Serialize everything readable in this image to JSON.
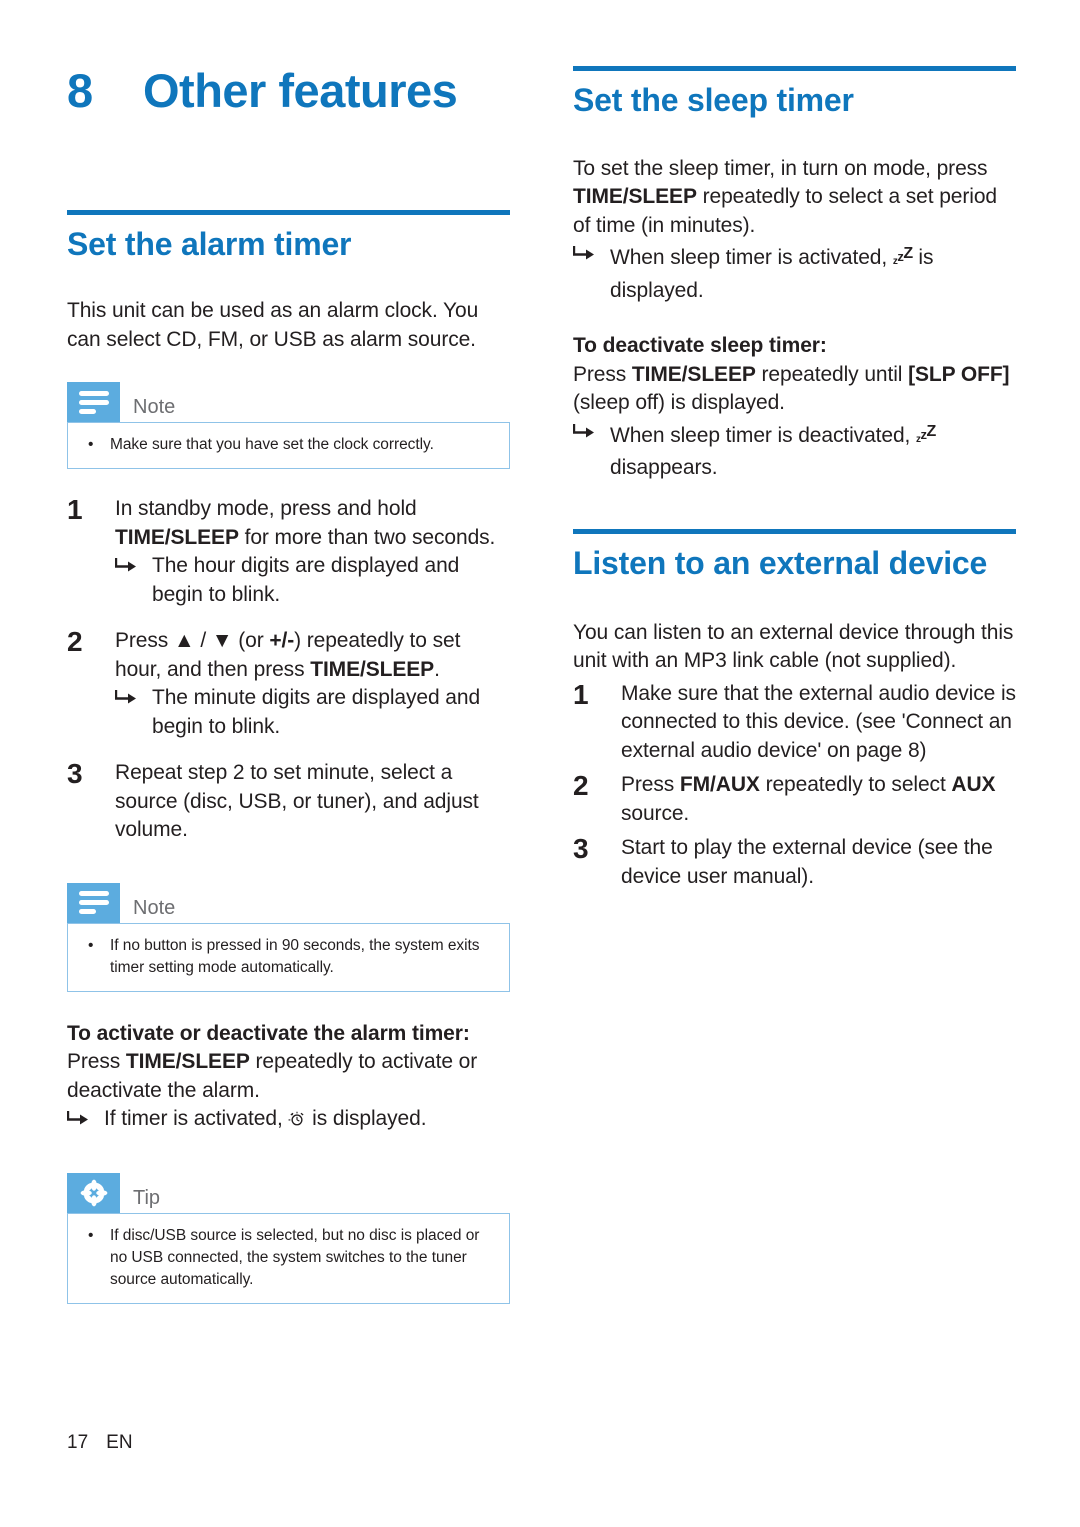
{
  "chapter": {
    "number": "8",
    "title": "Other features"
  },
  "footer": {
    "page": "17",
    "lang": "EN"
  },
  "colors": {
    "heading_blue": "#0f76bc",
    "callout_icon_blue": "#5cacdf",
    "callout_border_blue": "#8fc3e8",
    "body_text": "#231f20",
    "callout_label_gray": "#6d6e71"
  },
  "left_column": {
    "alarm_section": {
      "title": "Set the alarm timer",
      "intro": "This unit can be used as an alarm clock. You can select CD, FM, or USB as alarm source.",
      "note1": {
        "label": "Note",
        "icon": "note-lines-icon",
        "items": [
          "Make sure that you have set the clock correctly."
        ]
      },
      "steps": [
        {
          "num": "1",
          "text_parts": [
            {
              "t": "In standby mode, press and hold ",
              "b": false
            },
            {
              "t": "TIME/SLEEP",
              "b": true
            },
            {
              "t": " for more than two seconds.",
              "b": false
            }
          ],
          "results": [
            "The hour digits are displayed and begin to blink."
          ]
        },
        {
          "num": "2",
          "text_parts": [
            {
              "t": "Press ▲ / ▼ (or ",
              "b": false
            },
            {
              "t": "+/-",
              "b": true
            },
            {
              "t": ") repeatedly to set hour, and then press ",
              "b": false
            },
            {
              "t": "TIME/SLEEP",
              "b": true
            },
            {
              "t": ".",
              "b": false
            }
          ],
          "results": [
            "The minute digits are displayed and begin to blink."
          ]
        },
        {
          "num": "3",
          "text_parts": [
            {
              "t": "Repeat step 2 to set minute, select a source (disc, USB, or tuner), and adjust volume.",
              "b": false
            }
          ],
          "results": []
        }
      ],
      "note2": {
        "label": "Note",
        "icon": "note-lines-icon",
        "items": [
          "If no button is pressed in 90 seconds, the system exits timer setting mode automatically."
        ]
      },
      "activate_heading": "To activate or deactivate the alarm timer:",
      "activate_parts": [
        {
          "t": "Press ",
          "b": false
        },
        {
          "t": "TIME/SLEEP",
          "b": true
        },
        {
          "t": " repeatedly to activate or deactivate the alarm.",
          "b": false
        }
      ],
      "activate_result_before": "If timer is activated, ",
      "activate_result_glyph": "alarm-clock-glyph",
      "activate_result_after": " is displayed.",
      "tip": {
        "label": "Tip",
        "icon": "tip-asterisk-icon",
        "items": [
          "If disc/USB source is selected, but no disc is placed or no USB connected, the system switches to the tuner source automatically."
        ]
      }
    }
  },
  "right_column": {
    "sleep_section": {
      "title": "Set the sleep timer",
      "intro_parts": [
        {
          "t": "To set the sleep timer, in turn on mode, press ",
          "b": false
        },
        {
          "t": "TIME/SLEEP",
          "b": true
        },
        {
          "t": " repeatedly to select a set period of time (in minutes).",
          "b": false
        }
      ],
      "intro_result_before": "When sleep timer is activated, ",
      "intro_result_glyph": "sleep-zzz-glyph",
      "intro_result_after": " is displayed.",
      "deactivate_heading": "To deactivate sleep timer:",
      "deactivate_parts": [
        {
          "t": "Press ",
          "b": false
        },
        {
          "t": "TIME/SLEEP",
          "b": true
        },
        {
          "t": " repeatedly until ",
          "b": false
        },
        {
          "t": "[SLP OFF]",
          "b": true
        },
        {
          "t": " (sleep off) is displayed.",
          "b": false
        }
      ],
      "deactivate_result_before": "When sleep timer is deactivated, ",
      "deactivate_result_glyph": "sleep-zzz-glyph",
      "deactivate_result_after": " disappears."
    },
    "external_section": {
      "title": "Listen to an external device",
      "intro": "You can listen to an external device through this unit with an MP3 link cable (not supplied).",
      "steps": [
        {
          "num": "1",
          "text_parts": [
            {
              "t": "Make sure that the external audio device is connected to this device. (see 'Connect an external audio device' on page 8)",
              "b": false
            }
          ]
        },
        {
          "num": "2",
          "text_parts": [
            {
              "t": "Press ",
              "b": false
            },
            {
              "t": "FM/AUX",
              "b": true
            },
            {
              "t": " repeatedly to select ",
              "b": false
            },
            {
              "t": "AUX",
              "b": true
            },
            {
              "t": " source.",
              "b": false
            }
          ]
        },
        {
          "num": "3",
          "text_parts": [
            {
              "t": "Start to play the external device (see the device user manual).",
              "b": false
            }
          ]
        }
      ]
    }
  },
  "glyphs": {
    "bullet": "•",
    "arrow": "↳",
    "zzz": [
      "z",
      "z",
      "Z"
    ]
  }
}
